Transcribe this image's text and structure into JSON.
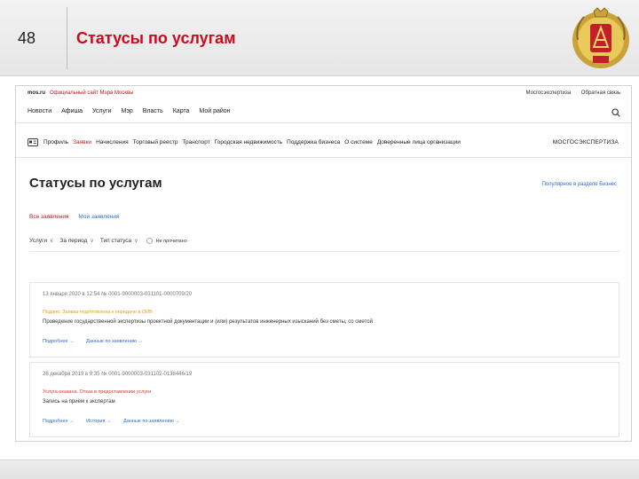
{
  "slide": {
    "number": "48",
    "title": "Статусы по услугам"
  },
  "site": {
    "brand": "mos.ru",
    "brand_caption": "Официальный сайт Мэра Москвы",
    "top_links": [
      "Мосгосэкспертиза",
      "Обратная связь"
    ],
    "nav": [
      "Новости",
      "Афиша",
      "Услуги",
      "Мэр",
      "Власть",
      "Карта",
      "Мой район"
    ],
    "search_icon": "search-icon"
  },
  "subnav": {
    "items": [
      "Профиль",
      "Заявки",
      "Начисления",
      "Торговый реестр",
      "Транспорт",
      "Городская недвижимость",
      "Поддержка бизнеса",
      "О системе",
      "Доверенные лица организации"
    ],
    "active_index": 1,
    "org": "МОСГОСЭКСПЕРТИЗА"
  },
  "page": {
    "title": "Статусы по услугам",
    "popular_link": "Популярное в разделе Бизнес",
    "tabs": [
      "Все заявления",
      "Мои заявления"
    ],
    "filters": [
      "Услуги",
      "За период",
      "Тип статуса"
    ],
    "unread_label": "Не прочитано"
  },
  "cards": [
    {
      "meta": "13 января 2020 в 12:54  № 0001-9000003-031101-0000709/20",
      "status": "Подано. Заявка подготовлена к передаче в ОИВ",
      "description": "Проведение государственной экспертизы проектной документации и (или) результатов инженерных изысканий без сметы, со сметой",
      "links": [
        "Подробнее →",
        "Данные по заявлению →"
      ]
    },
    {
      "meta": "26 декабря 2019 в 9:35  № 0001-9000003-031102-0138446/19",
      "status": "Услуга оказана. Отказ в предоставлении услуги",
      "description": "Запись на приём к экспертам",
      "links": [
        "Подробнее →",
        "История →",
        "Данные по заявлению →"
      ]
    }
  ],
  "colors": {
    "slide_title": "#cc0a1a",
    "active": "#c4161c",
    "link": "#2d6bc9",
    "status_pending": "#e89a1a",
    "status_refused": "#d9342b"
  }
}
